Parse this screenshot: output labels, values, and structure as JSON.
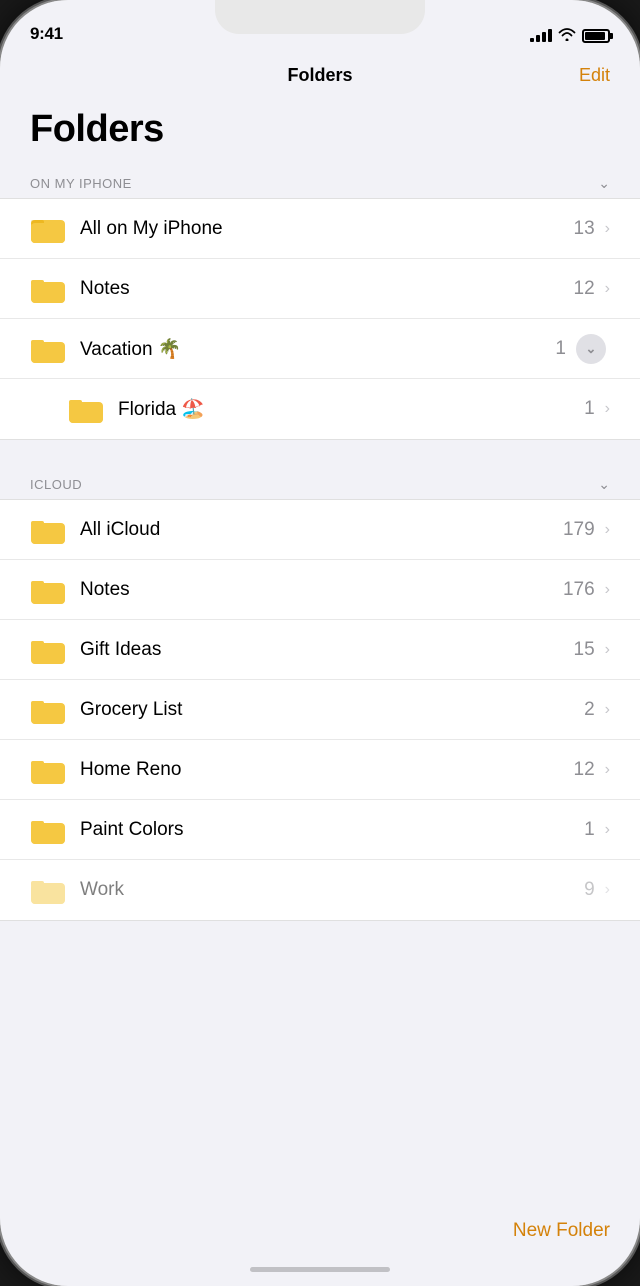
{
  "status_bar": {
    "time": "9:41"
  },
  "nav": {
    "title": "Folders",
    "edit_label": "Edit"
  },
  "page_title": "Folders",
  "sections": [
    {
      "id": "on_my_iphone",
      "label": "ON MY IPHONE",
      "folders": [
        {
          "name": "All on My iPhone",
          "count": "13",
          "expand": false,
          "sub": false
        },
        {
          "name": "Notes",
          "count": "12",
          "expand": false,
          "sub": false
        },
        {
          "name": "Vacation 🌴",
          "count": "1",
          "expand": true,
          "sub": false
        },
        {
          "name": "Florida 🏖️",
          "count": "1",
          "expand": false,
          "sub": true
        }
      ]
    },
    {
      "id": "icloud",
      "label": "ICLOUD",
      "folders": [
        {
          "name": "All iCloud",
          "count": "179",
          "expand": false,
          "sub": false
        },
        {
          "name": "Notes",
          "count": "176",
          "expand": false,
          "sub": false
        },
        {
          "name": "Gift Ideas",
          "count": "15",
          "expand": false,
          "sub": false
        },
        {
          "name": "Grocery List",
          "count": "2",
          "expand": false,
          "sub": false
        },
        {
          "name": "Home Reno",
          "count": "12",
          "expand": false,
          "sub": false
        },
        {
          "name": "Paint Colors",
          "count": "1",
          "expand": false,
          "sub": false
        },
        {
          "name": "Work",
          "count": "9",
          "expand": false,
          "sub": false,
          "partial": true
        }
      ]
    }
  ],
  "new_folder_label": "New Folder",
  "icons": {
    "chevron_right": "›",
    "chevron_down": "⌄",
    "expand_down": "⌄"
  }
}
